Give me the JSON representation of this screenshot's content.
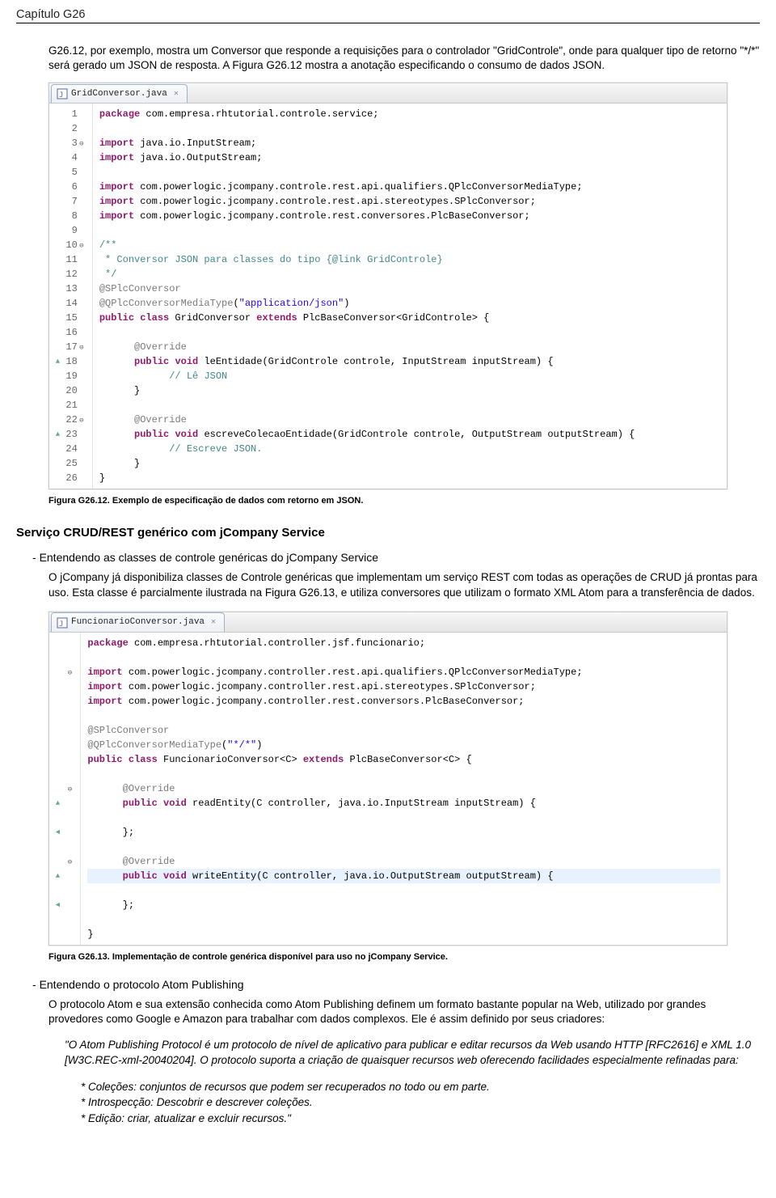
{
  "chapter": "Capítulo G26",
  "para1": "G26.12, por exemplo, mostra um Conversor que responde a requisições para o controlador \"GridControle\", onde para qualquer tipo de retorno \"*/*\" será gerado um JSON de resposta. A Figura G26.12 mostra a anotação especificando o consumo de dados JSON.",
  "fig1": {
    "tab": "GridConversor.java",
    "caption": "Figura G26.12. Exemplo de especificação de dados com retorno em JSON.",
    "lines": [
      {
        "n": 1,
        "t": "<span class='imp'>package</span> com.empresa.rhtutorial.controle.service;"
      },
      {
        "n": 2,
        "t": ""
      },
      {
        "n": 3,
        "f": "⊖",
        "t": "<span class='imp'>import</span> java.io.InputStream;"
      },
      {
        "n": 4,
        "t": "<span class='imp'>import</span> java.io.OutputStream;"
      },
      {
        "n": 5,
        "t": ""
      },
      {
        "n": 6,
        "t": "<span class='imp'>import</span> com.powerlogic.jcompany.controle.rest.api.qualifiers.QPlcConversorMediaType;"
      },
      {
        "n": 7,
        "t": "<span class='imp'>import</span> com.powerlogic.jcompany.controle.rest.api.stereotypes.SPlcConversor;"
      },
      {
        "n": 8,
        "t": "<span class='imp'>import</span> com.powerlogic.jcompany.controle.rest.conversores.PlcBaseConversor;"
      },
      {
        "n": 9,
        "t": ""
      },
      {
        "n": 10,
        "f": "⊖",
        "t": "<span class='cmt'>/**</span>"
      },
      {
        "n": 11,
        "t": "<span class='cmt'> * Conversor JSON para classes do tipo {@link GridControle}</span>"
      },
      {
        "n": 12,
        "t": "<span class='cmt'> */</span>"
      },
      {
        "n": 13,
        "t": "<span class='ann'>@SPlcConversor</span>"
      },
      {
        "n": 14,
        "t": "<span class='ann'>@QPlcConversorMediaType</span>(<span class='str'>\"application/json\"</span>)"
      },
      {
        "n": 15,
        "t": "<span class='kw'>public class</span> GridConversor <span class='kw'>extends</span> PlcBaseConversor&lt;GridControle&gt; {"
      },
      {
        "n": 16,
        "t": ""
      },
      {
        "n": 17,
        "f": "⊖",
        "t": "      <span class='ann'>@Override</span>"
      },
      {
        "n": 18,
        "m": "▲",
        "t": "      <span class='kw'>public void</span> leEntidade(GridControle controle, InputStream inputStream) {"
      },
      {
        "n": 19,
        "t": "            <span class='cmt'>// Lê JSON</span>"
      },
      {
        "n": 20,
        "t": "      }"
      },
      {
        "n": 21,
        "t": ""
      },
      {
        "n": 22,
        "f": "⊖",
        "t": "      <span class='ann'>@Override</span>"
      },
      {
        "n": 23,
        "m": "▲",
        "t": "      <span class='kw'>public void</span> escreveColecaoEntidade(GridControle controle, OutputStream outputStream) {"
      },
      {
        "n": 24,
        "t": "            <span class='cmt'>// Escreve JSON.</span>"
      },
      {
        "n": 25,
        "t": "      }"
      },
      {
        "n": 26,
        "t": "}"
      }
    ]
  },
  "section_head": "Serviço CRUD/REST genérico com jCompany Service",
  "bullet1": "Entendendo as classes de controle genéricas do jCompany Service",
  "para2": "O jCompany já disponibiliza classes de Controle genéricas que implementam um serviço REST com todas as operações de CRUD já prontas para uso. Esta classe é parcialmente ilustrada na Figura G26.13, e utiliza conversores que utilizam o formato XML Atom para a transferência de dados.",
  "fig2": {
    "tab": "FuncionarioConversor.java",
    "caption": "Figura G26.13. Implementação de controle genérica disponível para uso no jCompany Service.",
    "lines": [
      {
        "t": "<span class='imp'>package</span> com.empresa.rhtutorial.controller.jsf.funcionario;"
      },
      {
        "t": ""
      },
      {
        "f": "⊖",
        "t": "<span class='imp'>import</span> com.powerlogic.jcompany.controller.rest.api.qualifiers.QPlcConversorMediaType;"
      },
      {
        "t": "<span class='imp'>import</span> com.powerlogic.jcompany.controller.rest.api.stereotypes.SPlcConversor;"
      },
      {
        "t": "<span class='imp'>import</span> com.powerlogic.jcompany.controller.rest.conversors.PlcBaseConversor;"
      },
      {
        "t": ""
      },
      {
        "t": "<span class='ann'>@SPlcConversor</span>"
      },
      {
        "t": "<span class='ann'>@QPlcConversorMediaType</span>(<span class='str'>\"*/*\"</span>)"
      },
      {
        "t": "<span class='kw'>public class</span> FuncionarioConversor&lt;C&gt; <span class='kw'>extends</span> PlcBaseConversor&lt;C&gt; {"
      },
      {
        "t": ""
      },
      {
        "f": "⊖",
        "t": "      <span class='ann'>@Override</span>"
      },
      {
        "m": "▲",
        "t": "      <span class='kw'>public void</span> readEntity(C controller, java.io.InputStream inputStream) {"
      },
      {
        "t": ""
      },
      {
        "m": "◄",
        "t": "      };"
      },
      {
        "t": ""
      },
      {
        "f": "⊖",
        "t": "      <span class='ann'>@Override</span>"
      },
      {
        "m": "▲",
        "hl": true,
        "t": "      <span class='kw'>public void</span> writeEntity(C controller, java.io.OutputStream outputStream) {"
      },
      {
        "t": ""
      },
      {
        "m": "◄",
        "t": "      };"
      },
      {
        "t": ""
      },
      {
        "t": "}"
      }
    ]
  },
  "bullet2": "Entendendo o protocolo Atom Publishing",
  "para3": "O protocolo Atom e sua extensão conhecida como Atom Publishing definem um formato bastante popular na Web, utilizado por grandes provedores como Google e Amazon para trabalhar com dados complexos. Ele é assim definido por seus criadores:",
  "quote1": "\"O Atom Publishing Protocol é um protocolo de nível de aplicativo para publicar e editar recursos da Web usando HTTP [RFC2616] e XML 1.0 [W3C.REC-xml-20040204]. O protocolo suporta a criação de quaisquer recursos web oferecendo facilidades especialmente refinadas para:",
  "star1": "* Coleções: conjuntos de recursos que podem ser recuperados no todo ou em parte.",
  "star2": "* Introspecção: Descobrir e descrever coleções.",
  "star3": "* Edição: criar, atualizar e excluir recursos.\""
}
